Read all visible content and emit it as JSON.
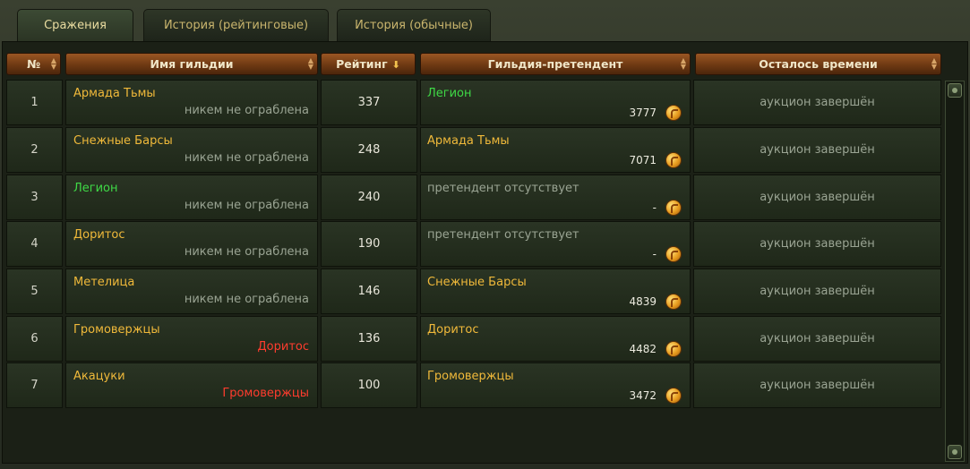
{
  "tabs": [
    {
      "label": "Сражения",
      "active": true
    },
    {
      "label": "История (рейтинговые)",
      "active": false
    },
    {
      "label": "История (обычные)",
      "active": false
    }
  ],
  "columns": {
    "num": "№",
    "guild": "Имя гильдии",
    "rating": "Рейтинг",
    "challenger": "Гильдия-претендент",
    "time_left": "Осталось времени"
  },
  "rows": [
    {
      "num": "1",
      "guild": "Армада Тьмы",
      "robbed": "никем не ограблена",
      "rating": "337",
      "challenger": "Легион",
      "bid": "3777",
      "time": "аукцион завершён"
    },
    {
      "num": "2",
      "guild": "Снежные Барсы",
      "robbed": "никем не ограблена",
      "rating": "248",
      "challenger": "Армада Тьмы",
      "bid": "7071",
      "time": "аукцион завершён"
    },
    {
      "num": "3",
      "guild": "Легион",
      "robbed": "никем не ограблена",
      "rating": "240",
      "challenger": "претендент отсутствует",
      "bid": "-",
      "time": "аукцион завершён"
    },
    {
      "num": "4",
      "guild": "Доритос",
      "robbed": "никем не ограблена",
      "rating": "190",
      "challenger": "претендент отсутствует",
      "bid": "-",
      "time": "аукцион завершён"
    },
    {
      "num": "5",
      "guild": "Метелица",
      "robbed": "никем не ограблена",
      "rating": "146",
      "challenger": "Снежные Барсы",
      "bid": "4839",
      "time": "аукцион завершён"
    },
    {
      "num": "6",
      "guild": "Громовержцы",
      "robbed": "Доритос",
      "rating": "136",
      "challenger": "Доритос",
      "bid": "4482",
      "time": "аукцион завершён"
    },
    {
      "num": "7",
      "guild": "Акацуки",
      "robbed": "Громовержцы",
      "rating": "100",
      "challenger": "Громовержцы",
      "bid": "3472",
      "time": "аукцион завершён"
    }
  ],
  "colors": {
    "guild_name": "#f0b93a",
    "guild_legion": "#3fd946",
    "robbed_by": "#ff3c2e",
    "muted": "#9aa493"
  },
  "icons": {
    "bid": "gold-coin-icon",
    "sort": "sort-desc-arrow-icon"
  }
}
